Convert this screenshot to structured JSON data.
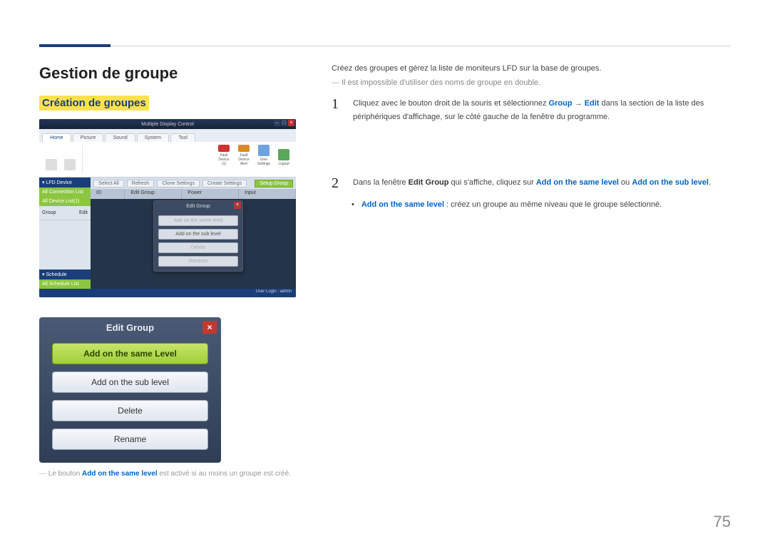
{
  "page_number": "75",
  "heading": "Gestion de groupe",
  "subheading": "Création de groupes",
  "footnote_prefix": "Le bouton ",
  "footnote_kw": "Add on the same level",
  "footnote_suffix": " est activé si au moins un groupe est créé.",
  "right": {
    "intro": "Créez des groupes et gérez la liste de moniteurs LFD sur la base de groupes.",
    "note": "Il est impossible d'utiliser des noms de groupe en double.",
    "step1_num": "1",
    "step1_a": "Cliquez avec le bouton droit de la souris et sélectionnez ",
    "step1_kw1": "Group",
    "step1_arrow": " → ",
    "step1_kw2": "Edit",
    "step1_b": " dans la section de la liste des périphériques d'affichage, sur le côté gauche de la fenêtre du programme.",
    "step2_num": "2",
    "step2_a": "Dans la fenêtre ",
    "step2_kw1": "Edit Group",
    "step2_b": " qui s'affiche, cliquez sur ",
    "step2_kw2": "Add on the same level",
    "step2_c": " ou ",
    "step2_kw3": "Add on the sub level",
    "step2_d": ".",
    "bullet1_kw": "Add on the same level",
    "bullet1_rest": " : créez un groupe au même niveau que le groupe sélectionné."
  },
  "shot1": {
    "title": "Multiple Display Control",
    "tabs": [
      "Home",
      "Picture",
      "Sound",
      "System",
      "Tool"
    ],
    "ribbon": [
      "Fault Device (1)",
      "Fault Device Alert",
      "User Settings",
      "Logout"
    ],
    "side_hd": "▾ LFD Device",
    "side_sel": "All Connection List",
    "side_row_a": "Group",
    "side_row_b": "Edit",
    "side_hd2": "▾ Schedule",
    "side_grn2": "All Schedule List",
    "toolbar": [
      "Select All",
      "Refresh",
      "Clone Settings",
      "Create Settings",
      "Setup Group"
    ],
    "cols": [
      "ID",
      "Edit Group",
      "Power",
      "Input"
    ],
    "dialog_title": "Edit Group",
    "dialog_btns": [
      "Add on the same level",
      "Add on the sub level",
      "Delete",
      "Rename"
    ],
    "status": "User Login : admin",
    "all_device": "All Device List(1)"
  },
  "shot2": {
    "title": "Edit Group",
    "btns": [
      "Add on the same Level",
      "Add on the sub level",
      "Delete",
      "Rename"
    ]
  }
}
